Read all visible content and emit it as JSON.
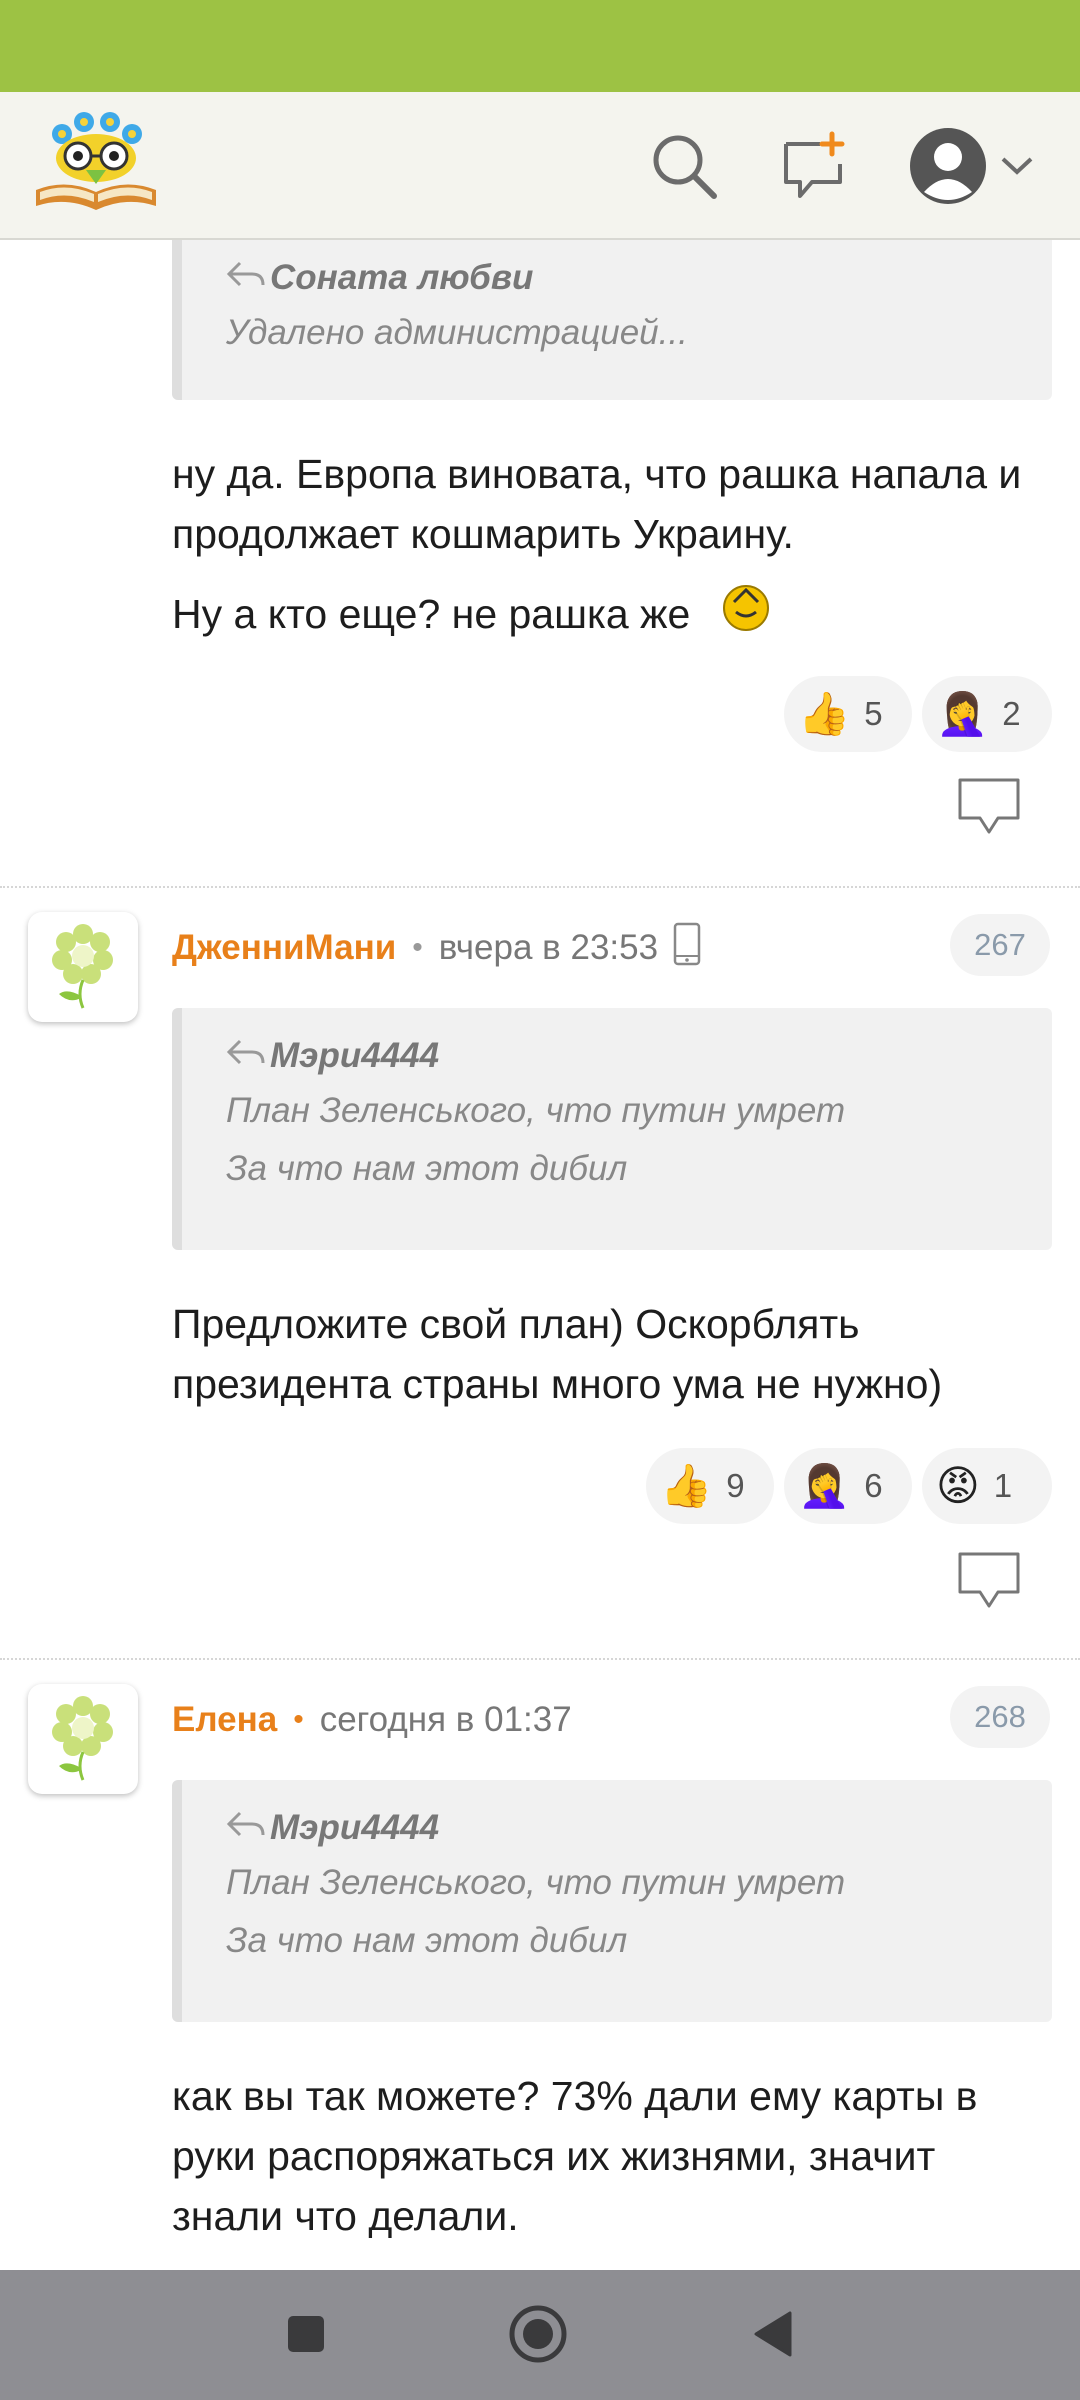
{
  "header": {
    "logo_icon": "owl-on-book-logo",
    "search_icon": "search-icon",
    "new_post_icon": "new-message-icon",
    "profile_icon": "user-avatar-icon"
  },
  "comments": [
    {
      "quote": {
        "author": "Соната любви",
        "lines": [
          "Удалено администрацией..."
        ]
      },
      "paragraphs": [
        "ну да. Европа виновата, что рашка напала и продолжает кошмарить Украину.",
        "Ну а кто еще? не рашка же"
      ],
      "reactions": [
        {
          "emoji": "👍",
          "count": "5"
        },
        {
          "emoji": "🤦‍♀️",
          "count": "2"
        }
      ]
    },
    {
      "author": "ДженниМани",
      "time": "вчера в 23:53",
      "number": "267",
      "quote": {
        "author": "Мэри4444",
        "lines": [
          "План Зеленського, что путин умрет",
          "За что нам этот дибил"
        ]
      },
      "paragraphs": [
        "Предложите свой план) Оскорблять президента страны много ума не нужно)"
      ],
      "reactions": [
        {
          "emoji": "👍",
          "count": "9"
        },
        {
          "emoji": "🤦‍♀️",
          "count": "6"
        },
        {
          "emoji": "😡",
          "count": "1"
        }
      ]
    },
    {
      "author": "Елена",
      "time": "сегодня в 01:37",
      "number": "268",
      "quote": {
        "author": "Мэри4444",
        "lines": [
          "План Зеленського, что путин умрет",
          "За что нам этот дибил"
        ]
      },
      "paragraphs": [
        "как вы так можете? 73% дали ему карты в руки распоряжаться их жизнями, значит знали что делали."
      ]
    }
  ],
  "colors": {
    "status_bar": "#9dc244",
    "username": "#e8801a",
    "header_bg": "#f4f4ee"
  }
}
